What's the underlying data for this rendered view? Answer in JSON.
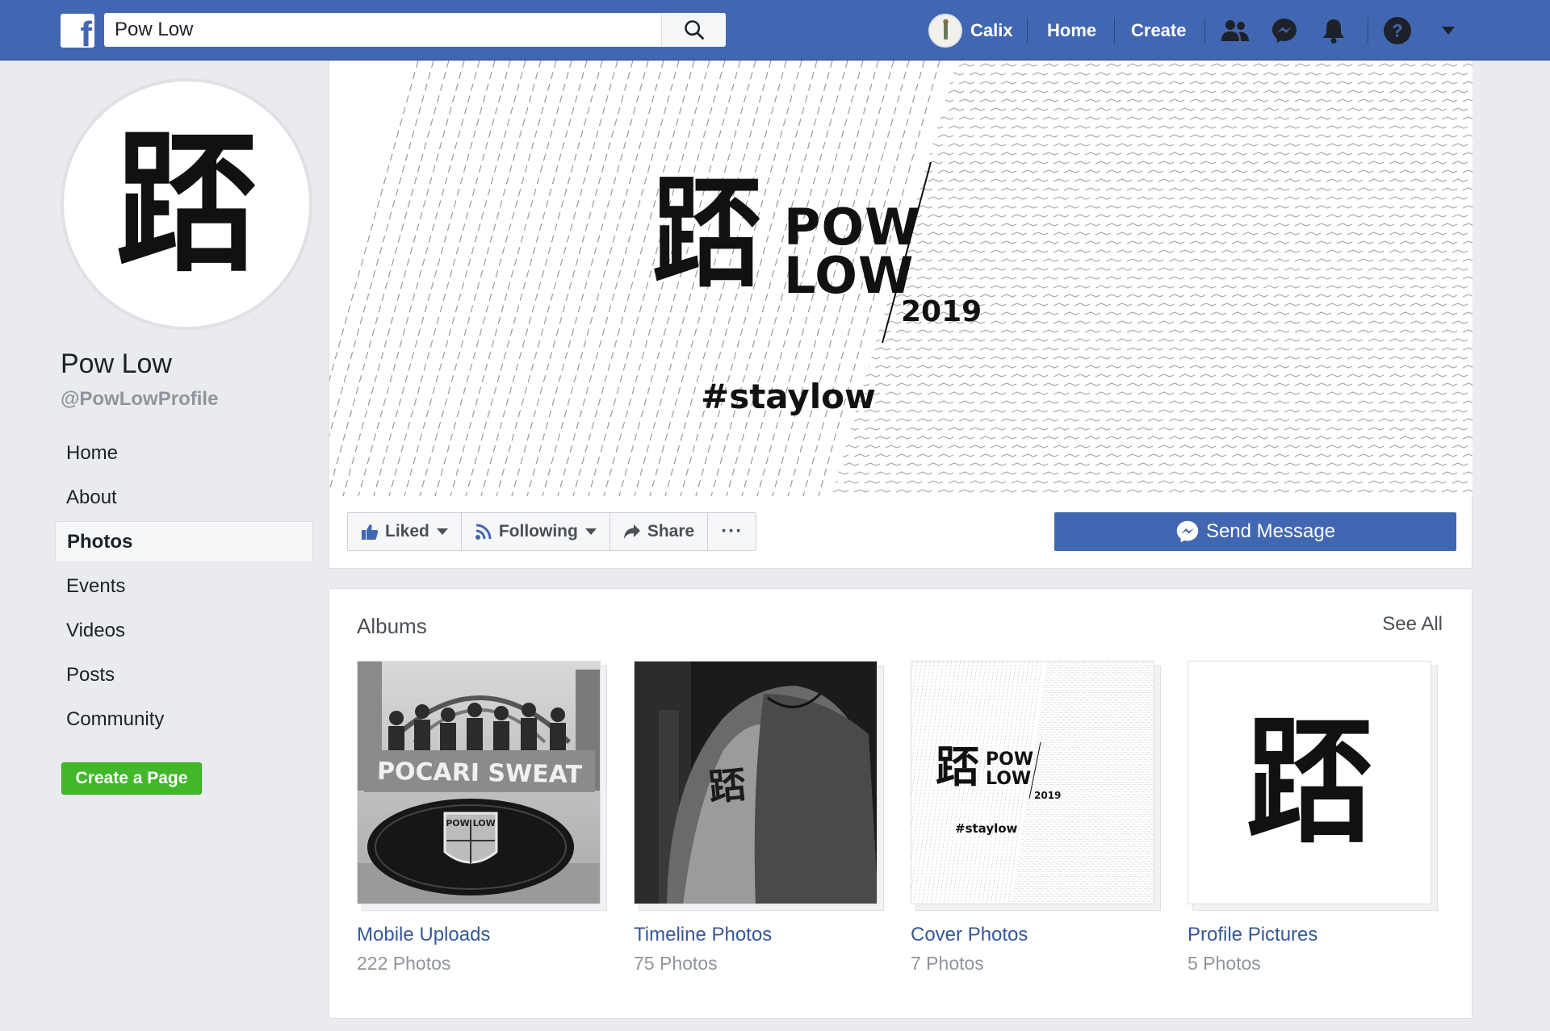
{
  "topbar": {
    "search_value": "Pow Low",
    "user_name": "Calix",
    "home_label": "Home",
    "create_label": "Create",
    "icons": [
      "facebook-logo",
      "search-icon",
      "friends-icon",
      "messenger-icon",
      "notifications-icon",
      "help-icon",
      "dropdown-icon"
    ]
  },
  "profile": {
    "glyph": "踎",
    "name": "Pow Low",
    "handle": "@PowLowProfile"
  },
  "left_nav": {
    "items": [
      {
        "label": "Home",
        "active": false
      },
      {
        "label": "About",
        "active": false
      },
      {
        "label": "Photos",
        "active": true
      },
      {
        "label": "Events",
        "active": false
      },
      {
        "label": "Videos",
        "active": false
      },
      {
        "label": "Posts",
        "active": false
      },
      {
        "label": "Community",
        "active": false
      }
    ],
    "create_page_label": "Create a Page"
  },
  "cover": {
    "glyph": "踎",
    "word_1": "POW",
    "word_2": "LOW",
    "year": "2019",
    "hashtag": "#staylow"
  },
  "actions": {
    "liked_label": "Liked",
    "following_label": "Following",
    "share_label": "Share",
    "more_label": "···",
    "send_message_label": "Send Message"
  },
  "albums": {
    "title": "Albums",
    "see_all": "See All",
    "items": [
      {
        "name": "Mobile Uploads",
        "count": "222 Photos",
        "banner_text": "POCARI SWEAT",
        "badge_text": "POW LOW"
      },
      {
        "name": "Timeline Photos",
        "count": "75 Photos",
        "tattoo_glyph": "踎"
      },
      {
        "name": "Cover Photos",
        "count": "7 Photos",
        "glyph": "踎",
        "word_1": "POW",
        "word_2": "LOW",
        "year": "2019",
        "hashtag": "#staylow"
      },
      {
        "name": "Profile Pictures",
        "count": "5 Photos",
        "glyph": "踎"
      }
    ]
  },
  "colors": {
    "brand_blue": "#4267b2",
    "link_blue": "#365899",
    "green": "#42b72a",
    "page_bg": "#e9ebee"
  }
}
